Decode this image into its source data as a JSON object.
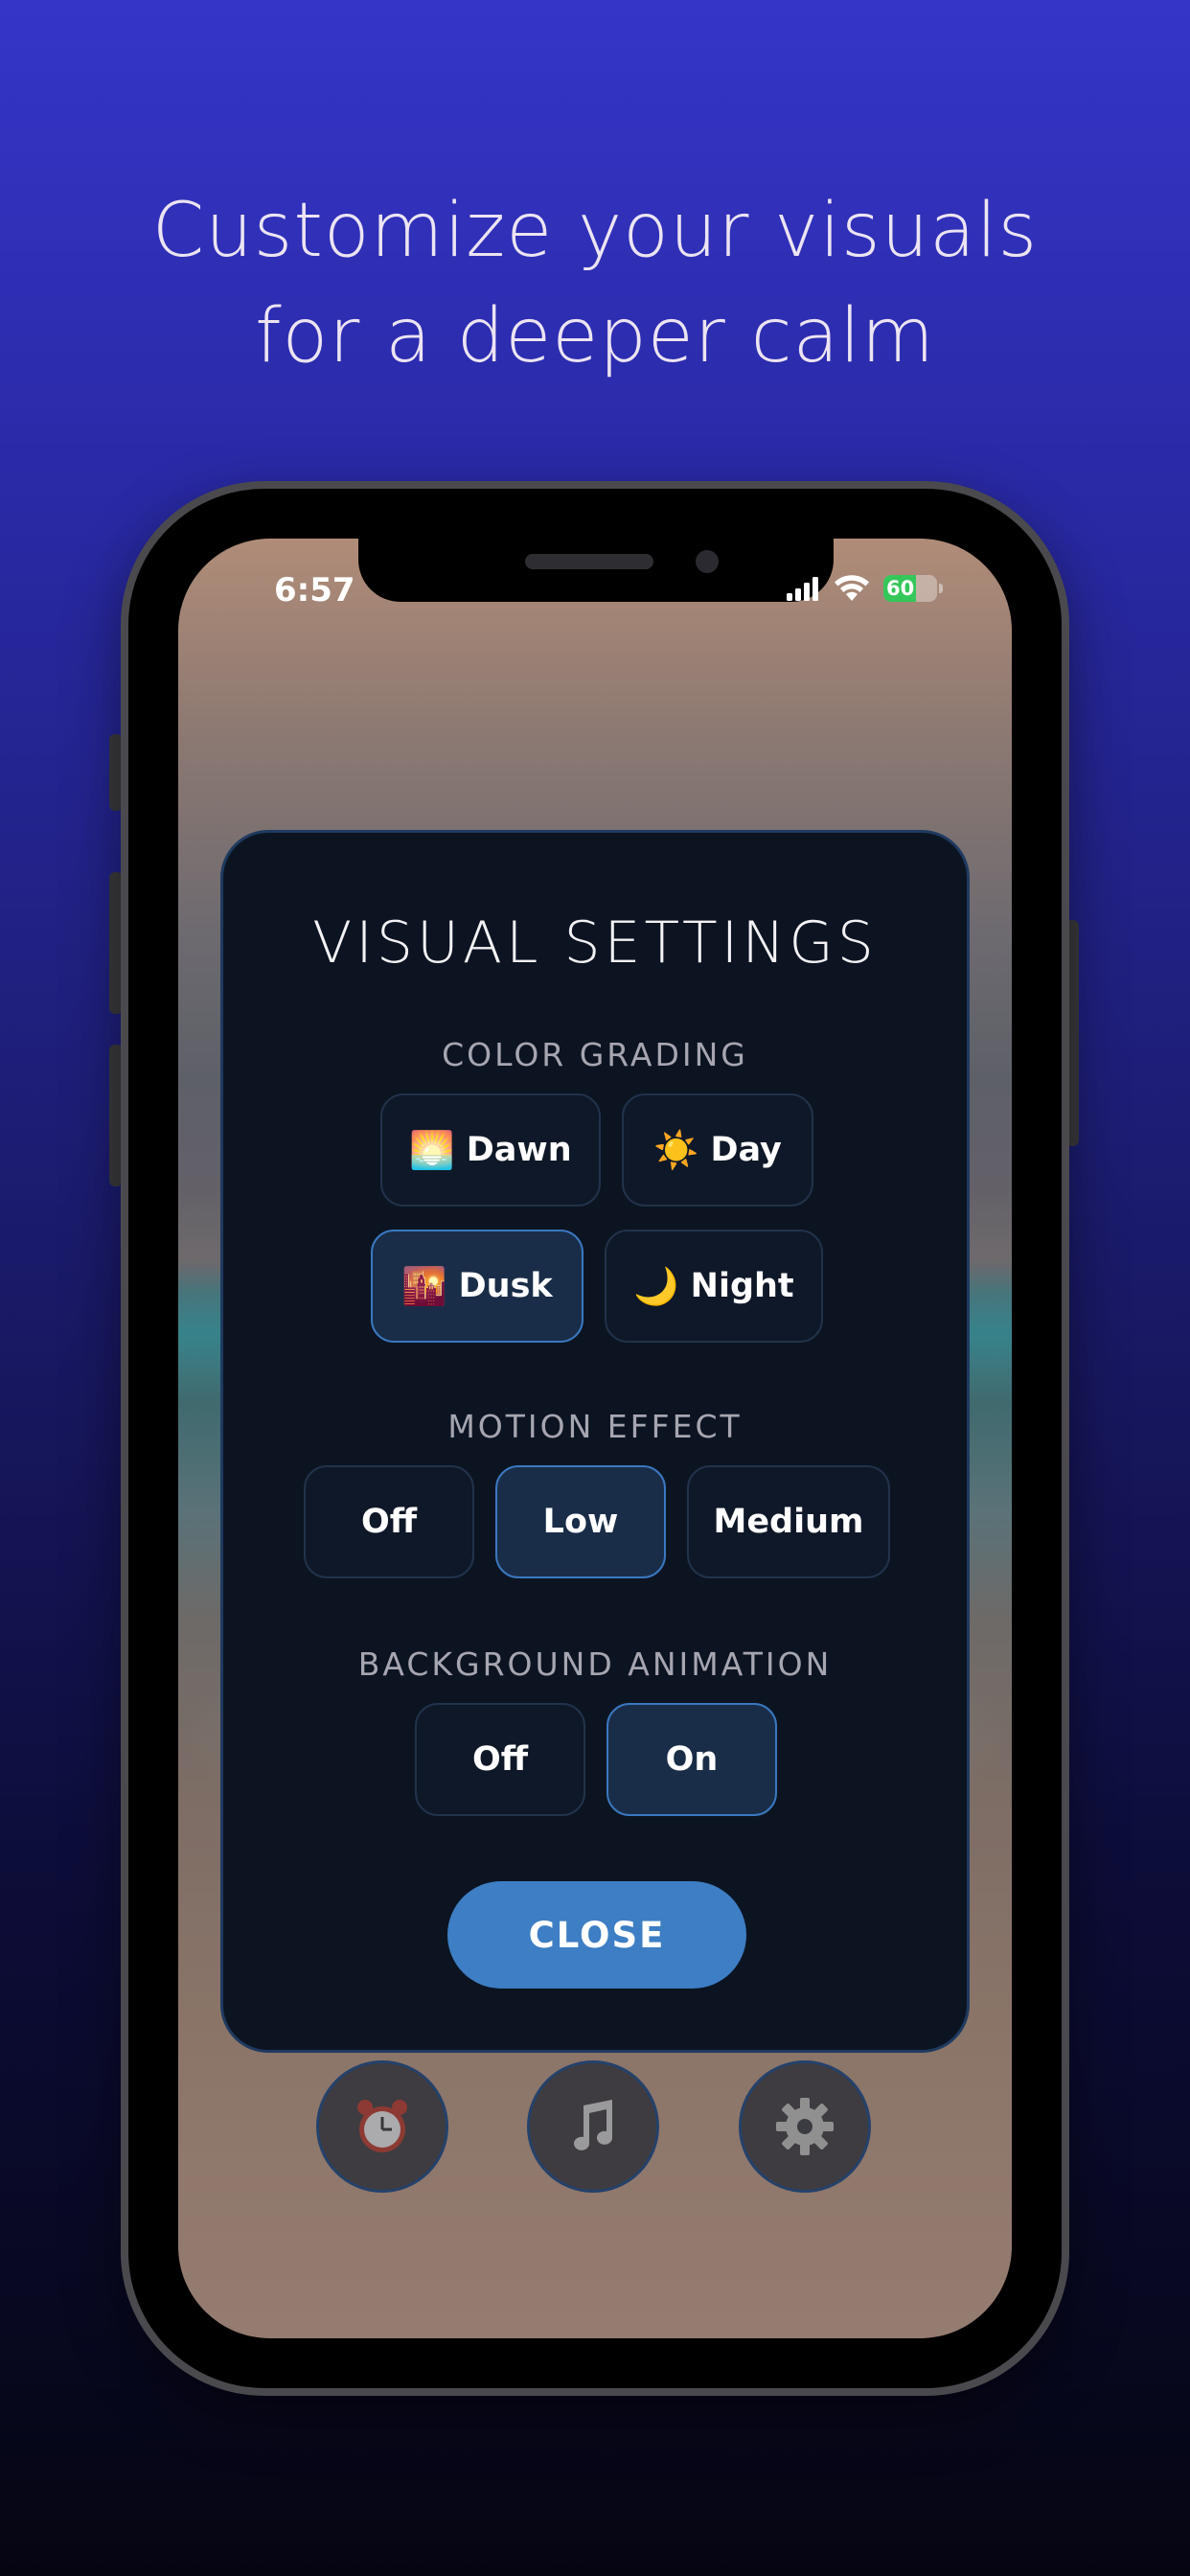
{
  "headline": {
    "line1": "Customize your visuals",
    "line2": "for a deeper calm"
  },
  "status_bar": {
    "time": "6:57",
    "battery_level": "60",
    "battery_fraction": 0.6,
    "icons": [
      "cellular-signal-icon",
      "wifi-icon",
      "battery-charging-icon"
    ]
  },
  "modal": {
    "title": "VISUAL SETTINGS",
    "color_grading": {
      "label": "COLOR GRADING",
      "options": [
        {
          "emoji": "🌅",
          "label": "Dawn",
          "selected": false
        },
        {
          "emoji": "☀️",
          "label": "Day",
          "selected": false
        },
        {
          "emoji": "🌇",
          "label": "Dusk",
          "selected": true
        },
        {
          "emoji": "🌙",
          "label": "Night",
          "selected": false
        }
      ]
    },
    "motion_effect": {
      "label": "MOTION EFFECT",
      "options": [
        {
          "label": "Off",
          "selected": false
        },
        {
          "label": "Low",
          "selected": true
        },
        {
          "label": "Medium",
          "selected": false
        }
      ]
    },
    "background_animation": {
      "label": "BACKGROUND ANIMATION",
      "options": [
        {
          "label": "Off",
          "selected": false
        },
        {
          "label": "On",
          "selected": true
        }
      ]
    },
    "close_label": "CLOSE"
  },
  "dock": {
    "icons": [
      "alarm-clock-icon",
      "music-note-icon",
      "gear-icon"
    ]
  },
  "colors": {
    "accent": "#3d7ec4",
    "selected_border": "#3a78c0",
    "modal_bg": "#0c1422",
    "battery_green": "#34c759"
  }
}
